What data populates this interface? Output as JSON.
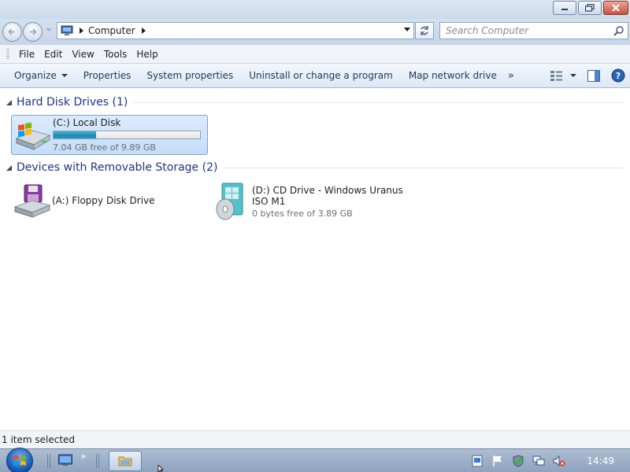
{
  "window": {
    "minimize_icon": "minimize-icon",
    "maximize_icon": "restore-icon",
    "close_icon": "close-icon"
  },
  "address": {
    "location_icon": "computer-icon",
    "breadcrumb": "Computer",
    "search_placeholder": "Search Computer"
  },
  "menu": {
    "items": [
      "File",
      "Edit",
      "View",
      "Tools",
      "Help"
    ]
  },
  "toolbar": {
    "organize": "Organize",
    "properties": "Properties",
    "system_properties": "System properties",
    "uninstall": "Uninstall or change a program",
    "map_drive": "Map network drive",
    "more": "»"
  },
  "groups": {
    "hard_disks": "Hard Disk Drives (1)",
    "removable": "Devices with Removable Storage (2)"
  },
  "drives": {
    "c": {
      "name": "(C:) Local Disk",
      "free": "7.04 GB free of 9.89 GB",
      "used_fraction": 0.288
    },
    "a": {
      "name": "(A:) Floppy Disk Drive"
    },
    "d": {
      "name_line1": "(D:) CD Drive - Windows Uranus",
      "name_line2": "ISO M1",
      "free": "0 bytes free of 3.89 GB"
    }
  },
  "status": {
    "text": "1 item selected"
  },
  "taskbar": {
    "chevron": "»",
    "clock": "14:49"
  },
  "colors": {
    "selection": "#cde3fb",
    "usage_fill": "#2a9cc9",
    "group_title": "#1e3287"
  }
}
